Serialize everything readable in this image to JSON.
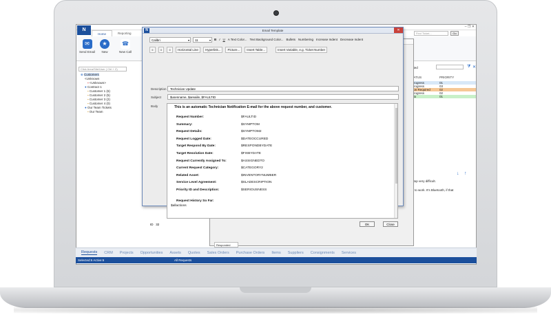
{
  "app": {
    "logo_letter": "N",
    "window_controls": "– ❐ ✕",
    "menu_tabs": [
      "Home",
      "Reporting",
      "Sales",
      "Billing",
      "Tools",
      "View"
    ],
    "find_placeholder": "Find Ticket...",
    "go_label": "Go",
    "ribbon": {
      "send_email": "Send Email",
      "new": "New",
      "new_call": "New Call"
    }
  },
  "left": {
    "search_placeholder": "Click Area/Site/User  ( Ctrl + Z)",
    "tree": [
      "Customers",
      "<Unknown",
      "<Unknown>",
      "Contract 1",
      "Customer 1 (6)",
      "Customer 2 (5)",
      "Customer 3 (2)",
      "Customer 4 (0)",
      "Our Team Tickets",
      "Our Team"
    ]
  },
  "setup": {
    "title": "Setup / Advanced Options",
    "subtitle": "Standard Messages Group: Email Templates List"
  },
  "email_template": {
    "title": "Email Template",
    "font": "Calibri",
    "size": "11",
    "toolbar1": [
      "B",
      "I",
      "U",
      "A Text Color...",
      "Text Background Color...",
      "Bullets",
      "Numbering",
      "Increase Indent",
      "Decrease Indent"
    ],
    "toolbar2": [
      "Horizontal Line",
      "Hyperlink...",
      "Picture...",
      "Insert Table..."
    ],
    "insert_variable": "Insert Variable, e.g. Ticket Number",
    "description_label": "Description",
    "description_value": "Technician Update",
    "subject_label": "Subject",
    "subject_value": "$usenname, $areaiile, $FAULTID",
    "body_label": "Body",
    "body_intro": "This is an automatic Technician Notification E-mail for the above request number, and customer.",
    "fields": [
      {
        "k": "Request Number:",
        "v": "$FAULTID"
      },
      {
        "k": "Summary:",
        "v": "$SYMPTOM"
      },
      {
        "k": "Request Details:",
        "v": "$SYMPTOM2"
      },
      {
        "k": "Request Logged Date:",
        "v": "$DATEOCCURED"
      },
      {
        "k": "Target Respond By Date:",
        "v": "$RESPONDBYDATE"
      },
      {
        "k": "Target Resolution Date:",
        "v": "$FIXBYDATE"
      },
      {
        "k": "Request Currently Assigned To:",
        "v": "$ASSIGNEDTO"
      },
      {
        "k": "Current Request Category:",
        "v": "$CATEGORY2"
      },
      {
        "k": "Related Asset:",
        "v": "$INVENTORYNUMBER"
      },
      {
        "k": "Service Level Agreement:",
        "v": "$SLADESCRIPTION"
      },
      {
        "k": "Priority ID and Description:",
        "v": "$SERIOUSNESS"
      }
    ],
    "history_label": "Request History So Far:",
    "history_value": "$allactions",
    "id_label": "ID",
    "id_value": "32",
    "ok": "OK",
    "close": "Close"
  },
  "right": {
    "filter": "ated",
    "col_status": "TATUS",
    "col_priority": "PRIORITY",
    "rows": [
      {
        "status": "Progress",
        "priority": "01",
        "color": "#d8e8f8"
      },
      {
        "status": "Progress",
        "priority": "03",
        "color": "#ffffff"
      },
      {
        "status": "tion Required",
        "priority": "02",
        "color": "#f6c896"
      },
      {
        "status": "Progress",
        "priority": "02",
        "color": "#ffffff"
      },
      {
        "status": "ato",
        "priority": "01",
        "color": "#c8f0c8"
      }
    ],
    "text1": "ptop very difficult.",
    "text2": "rt to work. It's Bluetooth, if that"
  },
  "responded_tab": "Responded",
  "bottom_nav": [
    "Requests",
    "CRM",
    "Projects",
    "Opportunities",
    "Assets",
    "Quotes",
    "Sales Orders",
    "Purchase Orders",
    "Items",
    "Suppliers",
    "Consignments",
    "Services"
  ],
  "status": {
    "left": "Selected:6  Active:6",
    "right": "All Requests"
  },
  "colors": {
    "brand": "#1b4f9c",
    "nav_text": "#6b8ab6"
  }
}
